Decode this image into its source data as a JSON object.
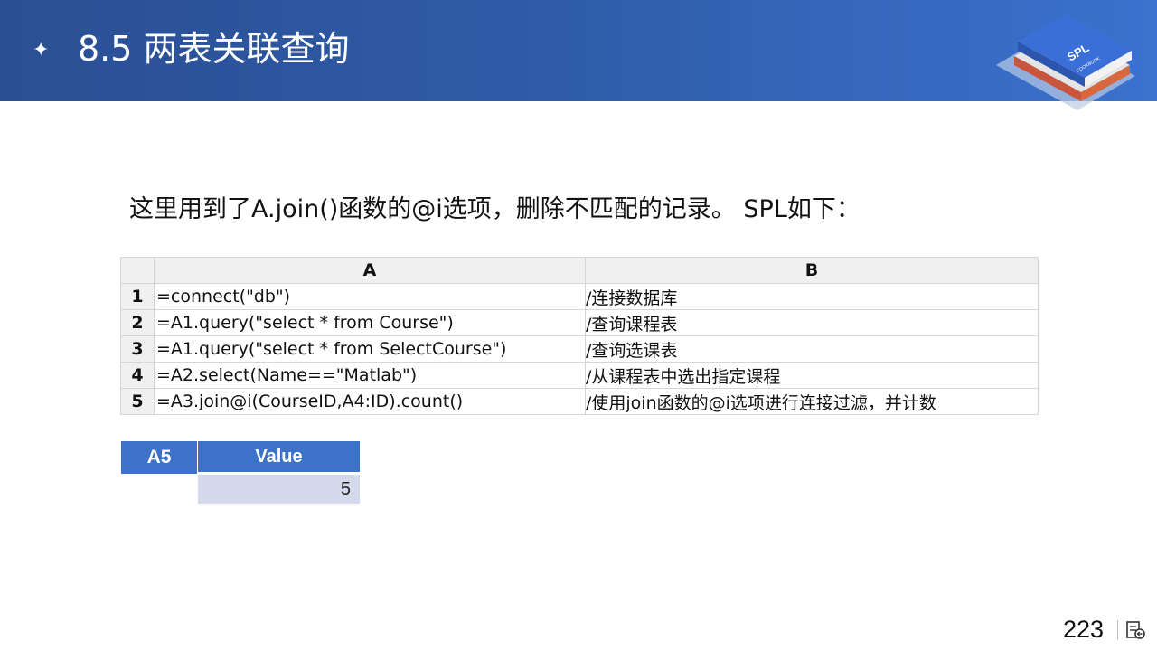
{
  "header": {
    "star": "✦",
    "title": "8.5 两表关联查询",
    "logo_text": "SPL",
    "logo_subtext": "COOKBOOK"
  },
  "intro": "这里用到了A.join()函数的@i选项，删除不匹配的记录。 SPL如下：",
  "grid": {
    "columns": [
      "A",
      "B"
    ],
    "rows": [
      {
        "num": "1",
        "a": "=connect(\"db\")",
        "b": "/连接数据库"
      },
      {
        "num": "2",
        "a": "=A1.query(\"select * from Course\")",
        "b": "/查询课程表"
      },
      {
        "num": "3",
        "a": "=A1.query(\"select * from SelectCourse\")",
        "b": "/查询选课表"
      },
      {
        "num": "4",
        "a": "=A2.select(Name==\"Matlab\")",
        "b": "/从课程表中选出指定课程"
      },
      {
        "num": "5",
        "a": "=A3.join@i(CourseID,A4:ID).count()",
        "b": "/使用join函数的@i选项进行连接过滤，并计数"
      }
    ]
  },
  "result": {
    "cell": "A5",
    "header": "Value",
    "value": "5"
  },
  "footer": {
    "page_number": "223"
  },
  "colors": {
    "header_blue": "#2f5ba6",
    "result_blue": "#3d72c9",
    "result_value_bg": "#d4d9eb"
  },
  "icons": {
    "bullet": "sparkle-icon",
    "logo": "book-stack-logo",
    "nav": "slide-nav-icon"
  }
}
